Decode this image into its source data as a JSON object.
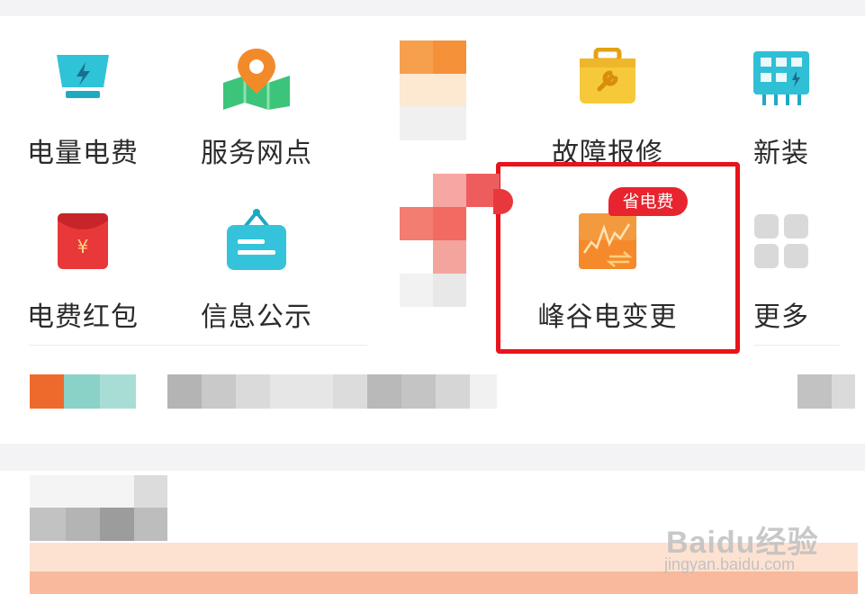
{
  "services": [
    {
      "id": "electricity-usage",
      "label": "电量电费",
      "icon": "lightning-screen-icon"
    },
    {
      "id": "service-outlets",
      "label": "服务网点",
      "icon": "map-pin-icon"
    },
    {
      "id": "fault-repair",
      "label": "故障报修",
      "icon": "toolbox-icon"
    },
    {
      "id": "new-install",
      "label": "新装",
      "icon": "meter-panel-icon"
    },
    {
      "id": "red-packet",
      "label": "电费红包",
      "icon": "red-envelope-icon"
    },
    {
      "id": "public-info",
      "label": "信息公示",
      "icon": "notice-board-icon"
    },
    {
      "id": "peak-valley",
      "label": "峰谷电变更",
      "icon": "peak-valley-chart-icon",
      "badge": "省电费"
    },
    {
      "id": "more",
      "label": "更多",
      "icon": "grid-more-icon"
    }
  ],
  "watermark": {
    "logo": "Baidu经验",
    "url": "jingyan.baidu.com"
  },
  "colors": {
    "highlight": "#e8141b",
    "badge": "#e8242e",
    "accent_orange": "#f08a2c"
  }
}
